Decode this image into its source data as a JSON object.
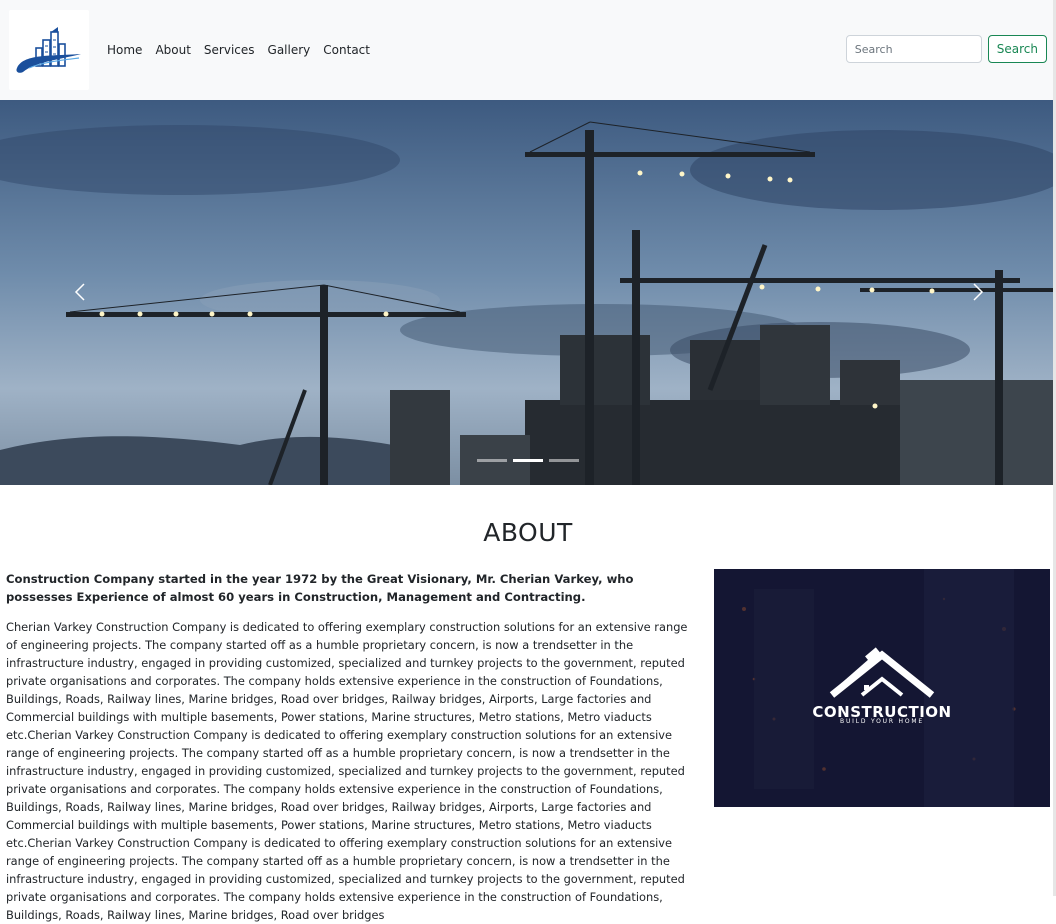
{
  "navbar": {
    "links": [
      "Home",
      "About",
      "Services",
      "Gallery",
      "Contact"
    ],
    "search_placeholder": "Search",
    "search_button": "Search"
  },
  "carousel": {
    "slide_count": 3,
    "active_index": 1
  },
  "about": {
    "title": "ABOUT",
    "lead": "Construction Company started in the year 1972 by the Great Visionary, Mr. Cherian Varkey, who possesses Experience of almost 60 years in Construction, Management and Contracting.",
    "body": "Cherian Varkey Construction Company is dedicated to offering exemplary construction solutions for an extensive range of engineering projects. The company started off as a humble proprietary concern, is now a trendsetter in the infrastructure industry, engaged in providing customized, specialized and turnkey projects to the government, reputed private organisations and corporates. The company holds extensive experience in the construction of Foundations, Buildings, Roads, Railway lines, Marine bridges, Road over bridges, Railway bridges, Airports, Large factories and Commercial buildings with multiple basements, Power stations, Marine structures, Metro stations, Metro viaducts etc.Cherian Varkey Construction Company is dedicated to offering exemplary construction solutions for an extensive range of engineering projects. The company started off as a humble proprietary concern, is now a trendsetter in the infrastructure industry, engaged in providing customized, specialized and turnkey projects to the government, reputed private organisations and corporates. The company holds extensive experience in the construction of Foundations, Buildings, Roads, Railway lines, Marine bridges, Road over bridges, Railway bridges, Airports, Large factories and Commercial buildings with multiple basements, Power stations, Marine structures, Metro stations, Metro viaducts etc.Cherian Varkey Construction Company is dedicated to offering exemplary construction solutions for an extensive range of engineering projects. The company started off as a humble proprietary concern, is now a trendsetter in the infrastructure industry, engaged in providing customized, specialized and turnkey projects to the government, reputed private organisations and corporates. The company holds extensive experience in the construction of Foundations, Buildings, Roads, Railway lines, Marine bridges, Road over bridges",
    "image_brand": "CONSTRUCTION",
    "image_tagline": "BUILD YOUR HOME"
  },
  "colors": {
    "navbar_bg": "#f8f9fa",
    "accent_green": "#198754",
    "logo_blue": "#1a4f9c",
    "about_image_bg": "#141633"
  },
  "icons": {
    "logo": "building-swoosh-logo",
    "prev": "chevron-left-icon",
    "next": "chevron-right-icon",
    "brand": "house-hammer-icon"
  }
}
